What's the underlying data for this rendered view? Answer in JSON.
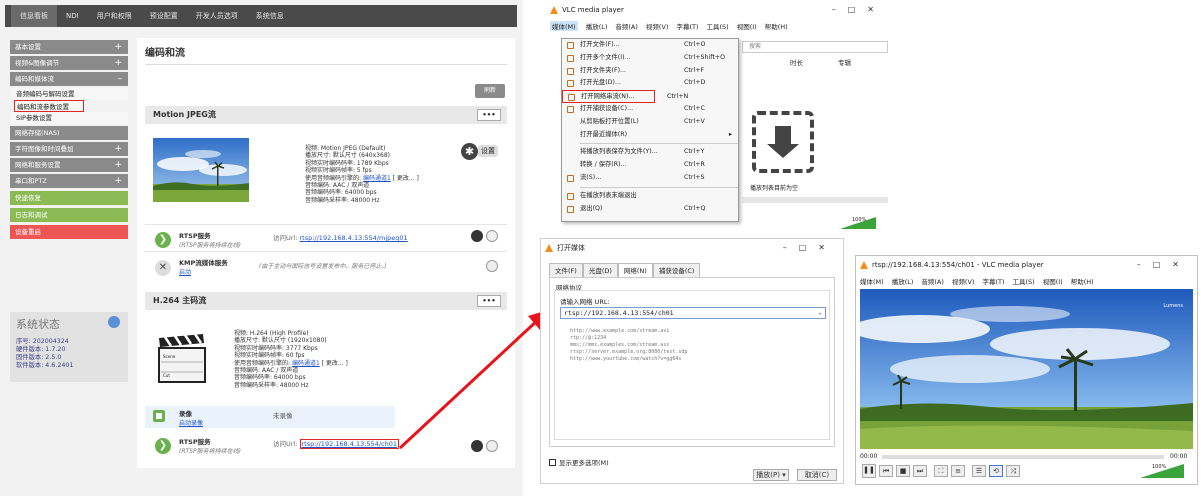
{
  "web": {
    "nav_tabs": [
      "信息看板",
      "NDI",
      "用户和权限",
      "预设配置",
      "开发人员选项",
      "系统信息"
    ],
    "sidebar": {
      "items": [
        {
          "label": "基本设置",
          "kind": "group",
          "plus": "+"
        },
        {
          "label": "视频&图像调节",
          "kind": "group",
          "plus": "+"
        },
        {
          "label": "编码和媒体流",
          "kind": "group",
          "plus": "–"
        },
        {
          "label": "音频编码与解码设置",
          "kind": "sub"
        },
        {
          "label": "编码和流参数设置",
          "kind": "sub",
          "highlighted": true
        },
        {
          "label": "SIP参数设置",
          "kind": "sub"
        },
        {
          "label": "网络存储(NAS)",
          "kind": "group"
        },
        {
          "label": "字符图像和时间叠加",
          "kind": "group",
          "plus": "+"
        },
        {
          "label": "网络和服务设置",
          "kind": "group",
          "plus": "+"
        },
        {
          "label": "串口和PTZ",
          "kind": "group",
          "plus": "+"
        },
        {
          "label": "快速恢复",
          "kind": "green"
        },
        {
          "label": "日志和调试",
          "kind": "green"
        },
        {
          "label": "设备重启",
          "kind": "red"
        }
      ]
    },
    "system_status": {
      "title": "系统状态",
      "lines": [
        "序号: 202004324",
        "硬件版本: 1.7.20",
        "固件版本: 2.5.0",
        "软件版本: 4.6.2401"
      ]
    },
    "content": {
      "title": "编码和流",
      "refresh_label": "刷新",
      "mjpeg": {
        "section_title": "Motion JPEG流",
        "dots": "•••",
        "settings_label": "设置",
        "info": [
          "视频: Motion JPEG (Default)",
          "播放尺寸: 默认尺寸 (640x368)",
          "视频实时编码码率: 1789 Kbps",
          "视频实时编码帧率: 5 fps"
        ],
        "audio_ref_prefix": "使用音频编码引擎的: ",
        "audio_ref_link": "编码通道1",
        "audio_ref_suffix": " [ 更改... ]",
        "info2": [
          "音频编码: AAC / 双声道",
          "音频编码码率: 64000 bps",
          "音频编码采样率: 48000 Hz"
        ],
        "rtsp_title": "RTSP服务",
        "rtsp_sub": "(RTSP服务将持续在线)",
        "rtsp_url_prefix": "访问Url: ",
        "rtsp_url": "rtsp://192.168.4.13:554/mjpeg01",
        "kmp_title": "KMP流媒体服务",
        "kmp_link": "启动",
        "kmp_note": "(由于主动与国际信号设置发布中。服务已停止。)"
      },
      "h264": {
        "section_title": "H.264 主码流",
        "dots": "•••",
        "info": [
          "视频: H.264 (High Profile)",
          "播放尺寸: 默认尺寸 (1920x1080)",
          "视频实时编码码率: 3777 Kbps",
          "视频实时编码帧率: 60 fps"
        ],
        "audio_ref_prefix": "使用音频编码引擎的: ",
        "audio_ref_link": "编码通道1",
        "audio_ref_suffix": " [ 更改... ]",
        "info2": [
          "音频编码: AAC / 双声道",
          "音频编码码率: 64000 bps",
          "音频编码采样率: 48000 Hz"
        ],
        "clapper_scene": "Scene",
        "clapper_cut": "Cut",
        "record_title": "录像",
        "record_link": "启动录像",
        "record_status": "未录像",
        "rtsp_title": "RTSP服务",
        "rtsp_sub": "(RTSP服务将持续在线)",
        "rtsp_url_prefix": "访问Url: ",
        "rtsp_url": "rtsp://192.168.4.13:554/ch01"
      }
    }
  },
  "vlc_main": {
    "title": "VLC media player",
    "menubar": [
      "媒体(M)",
      "播放(L)",
      "音频(A)",
      "视频(V)",
      "字幕(T)",
      "工具(S)",
      "视图(I)",
      "帮助(H)"
    ],
    "search_placeholder": "搜索",
    "columns": [
      "时长",
      "专辑"
    ],
    "menu_items": [
      {
        "label": "打开文件(F)...",
        "shortcut": "Ctrl+O"
      },
      {
        "label": "打开多个文件(I)...",
        "shortcut": "Ctrl+Shift+O"
      },
      {
        "label": "打开文件夹(F)...",
        "shortcut": "Ctrl+F"
      },
      {
        "label": "打开光盘(D)...",
        "shortcut": "Ctrl+D"
      },
      {
        "label": "打开网络串流(N)...",
        "shortcut": "Ctrl+N",
        "highlighted": true
      },
      {
        "label": "打开捕获设备(C)...",
        "shortcut": "Ctrl+C"
      },
      {
        "label": "从剪贴板打开位置(L)",
        "shortcut": "Ctrl+V"
      },
      {
        "label": "打开最近媒体(R)",
        "shortcut": "",
        "submenu": true
      },
      {
        "label": "将播放列表保存为文件(Y)...",
        "shortcut": "Ctrl+Y",
        "sep_before": true
      },
      {
        "label": "转换 / 保存(R)...",
        "shortcut": "Ctrl+R"
      },
      {
        "label": "流(S)...",
        "shortcut": "Ctrl+S"
      },
      {
        "label": "在播放列表末端退出",
        "shortcut": "",
        "sep_before": true
      },
      {
        "label": "退出(Q)",
        "shortcut": "Ctrl+Q"
      }
    ],
    "drop_hint": "播放列表目前为空",
    "volume": "100%"
  },
  "open_media": {
    "title": "打开媒体",
    "tabs": [
      "文件(F)",
      "光盘(D)",
      "网络(N)",
      "捕获设备(C)"
    ],
    "active_tab": 2,
    "group_title": "网络协议",
    "url_label": "请输入网络 URL:",
    "url_value": "rtsp://192.168.4.13:554/ch01",
    "examples": [
      "http://www.example.com/stream.avi",
      "rtp://@:1234",
      "mms://mms.examples.com/stream.asx",
      "rtsp://server.example.org:8080/test.sdp",
      "http://www.yourtube.com/watch?v=gg64x"
    ],
    "more_options": "显示更多选项(M)",
    "play_button": "播放(P)",
    "cancel_button": "取消(C)"
  },
  "vlc_player": {
    "title": "rtsp://192.168.4.13:554/ch01 - VLC media player",
    "menubar": [
      "媒体(M)",
      "播放(L)",
      "音频(A)",
      "视频(V)",
      "字幕(T)",
      "工具(S)",
      "视图(I)",
      "帮助(H)"
    ],
    "time_left": "00:00",
    "time_right": "00:00",
    "volume": "100%",
    "watermark": "Lumens"
  },
  "colors": {
    "highlight_red": "#e02424",
    "arrow_red": "#e8141b",
    "vlc_orange": "#f28c1a",
    "link_blue": "#2255cc",
    "green_btn": "#8cbb55"
  }
}
